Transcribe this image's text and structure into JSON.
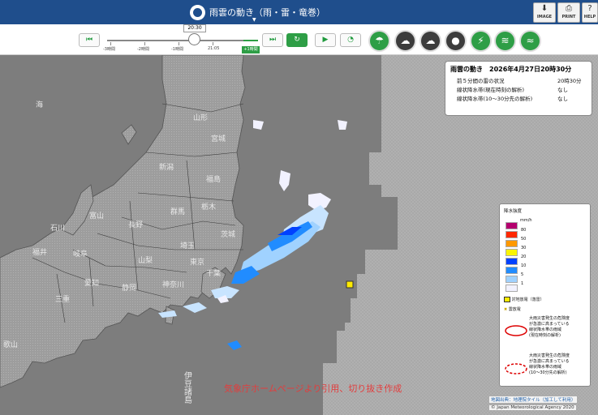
{
  "header": {
    "title": "雨雲の動き（雨・雷・竜巻）",
    "buttons": [
      {
        "name": "image-button",
        "label": "IMAGE",
        "icon": "download-icon"
      },
      {
        "name": "print-button",
        "label": "PRINT",
        "icon": "printer-icon"
      },
      {
        "name": "help-button",
        "label": "HELP",
        "icon": "question-icon"
      }
    ]
  },
  "toolbar": {
    "current_time": "20:30",
    "tick_labels": [
      "-3時間",
      "-2時間",
      "-1時間",
      "21:05"
    ],
    "plus_label": "+1時間",
    "colors": {
      "accent": "#2e9e46",
      "header": "#1f4e8c"
    }
  },
  "info": {
    "title": "雨雲の動き　2026年4月27日20時30分",
    "rows": [
      {
        "k": "前５分間の雷の状況",
        "v": "20時30分"
      },
      {
        "k": "線状降水帯(現在時刻の解析)",
        "v": "なし"
      },
      {
        "k": "線状降水帯(10～30分先の解析)",
        "v": "なし"
      }
    ]
  },
  "map": {
    "labels": [
      "海",
      "山形",
      "宮城",
      "新潟",
      "福島",
      "群馬",
      "栃木",
      "茨城",
      "富山",
      "石川",
      "長野",
      "埼玉",
      "福井",
      "岐阜",
      "山梨",
      "東京",
      "千葉",
      "愛知",
      "静岡",
      "神奈川",
      "三重",
      "歌山",
      "伊豆諸島"
    ]
  },
  "legend": {
    "title": "降水強度",
    "unit": "mm/h",
    "levels": [
      {
        "label": "80",
        "color": "#b4006e"
      },
      {
        "label": "50",
        "color": "#ff2800"
      },
      {
        "label": "30",
        "color": "#ff9900"
      },
      {
        "label": "20",
        "color": "#faf500"
      },
      {
        "label": "10",
        "color": "#0041ff"
      },
      {
        "label": "5",
        "color": "#218cff"
      },
      {
        "label": "1",
        "color": "#a0d2ff"
      },
      {
        "label": "",
        "color": "#f2f2ff"
      }
    ],
    "strike_label": "対地放電（落雷）",
    "cloud_label": "雲放電",
    "band_now": [
      "大雨災害発生の危険度",
      "が急激に高まっている",
      "線状降水帯の雨域",
      "(現在時刻の解析)"
    ],
    "band_future": [
      "大雨災害発生の危険度",
      "が急激に高まっている",
      "線状降水帯の雨域",
      "(10～30分先の解析)"
    ]
  },
  "watermark": "気象庁ホームページより引用、切り抜き作成",
  "credits": [
    "地図出典：地理院タイル（加工して利用）",
    "© Japan Meteorological Agency 2020"
  ]
}
